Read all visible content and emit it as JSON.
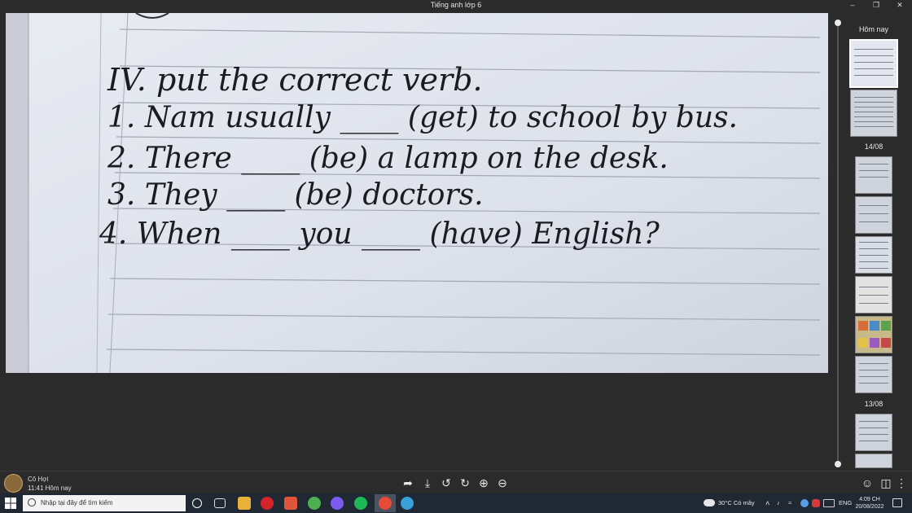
{
  "window": {
    "title": "Tiếng anh lớp 6",
    "minimize_icon": "minimize-icon",
    "restore_icon": "restore-icon",
    "close_icon": "close-icon"
  },
  "photo_text": {
    "heading": "IV. put the correct verb.",
    "line1": "1. Nam usually ____ (get) to school by bus.",
    "line2": "2. There ____ (be) a lamp on the desk.",
    "line3": "3. They ____ (be) doctors.",
    "line4": "4. When ____ you ____ (have) English?"
  },
  "gallery": {
    "sections": [
      "Hôm nay",
      "14/08",
      "13/08"
    ]
  },
  "message": {
    "sender": "Cô Hợi",
    "time": "11:41 Hôm nay"
  },
  "toolbar": {
    "icons": [
      "share-icon",
      "download-icon",
      "rotate-left-icon",
      "rotate-right-icon",
      "zoom-in-icon",
      "zoom-out-icon"
    ],
    "right_icons": [
      "add-reaction-icon",
      "layout-icon",
      "more-icon"
    ]
  },
  "taskbar": {
    "search_placeholder": "Nhập tại đây để tìm kiếm",
    "weather": "30°C  Có mây",
    "language": "ENG",
    "time": "4:09 CH",
    "date": "20/08/2022"
  }
}
